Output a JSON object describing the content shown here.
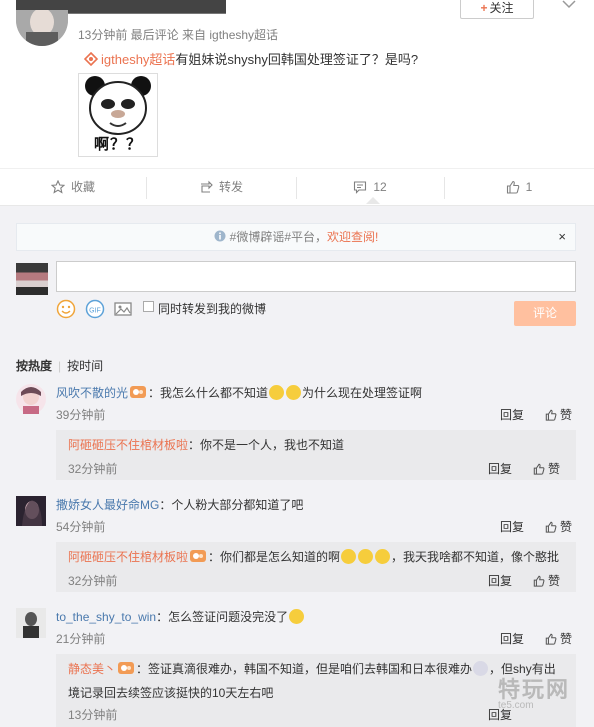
{
  "post": {
    "meta": "13分钟前 最后评论 来自 igtheshy超话",
    "follow_label": "关注",
    "tag": "igtheshy超话",
    "text": "有姐妹说shyshy回韩国处理签证了？是吗?",
    "meme_caption": "啊？？"
  },
  "actions": {
    "favorite": "收藏",
    "repost": "转发",
    "comment_count": "12",
    "like_count": "1"
  },
  "notice": {
    "prefix": "#微博辟谣#平台，",
    "highlight": "欢迎查阅!",
    "close": "×"
  },
  "composer": {
    "forward_label": "同时转发到我的微博",
    "submit_label": "评论"
  },
  "sort": {
    "hot": "按热度",
    "time": "按时间"
  },
  "comments": [
    {
      "user": "风吹不散的光",
      "text_a": "：我怎么什么都不知道",
      "text_b": "为什么现在处理签证啊",
      "time": "39分钟前",
      "reply": {
        "user": "阿砸砸压不住棺材板啦",
        "text": "：你不是一个人，我也不知道",
        "time": "32分钟前"
      }
    },
    {
      "user": "撒娇女人最好命MG",
      "text": "：个人粉大部分都知道了吧",
      "time": "54分钟前",
      "reply": {
        "user": "阿砸砸压不住棺材板啦",
        "text_a": "：你们都是怎么知道的啊",
        "text_b": "，我天我啥都不知道，像个憨批",
        "time": "32分钟前"
      }
    },
    {
      "user": "to_the_shy_to_win",
      "text": "：怎么签证问题没完没了",
      "time": "21分钟前",
      "reply": {
        "user": "静态美丶",
        "text_a": "：签证真滴很难办，韩国不知道，但是咱们去韩国和日本很难办",
        "text_b": "，但shy有出",
        "text_c": "境记录回去续签应该挺快的10天左右吧",
        "time": "13分钟前"
      }
    }
  ],
  "labels": {
    "reply": "回复",
    "like": "赞"
  },
  "watermark": {
    "big": "特玩网",
    "small": "te5.com"
  }
}
